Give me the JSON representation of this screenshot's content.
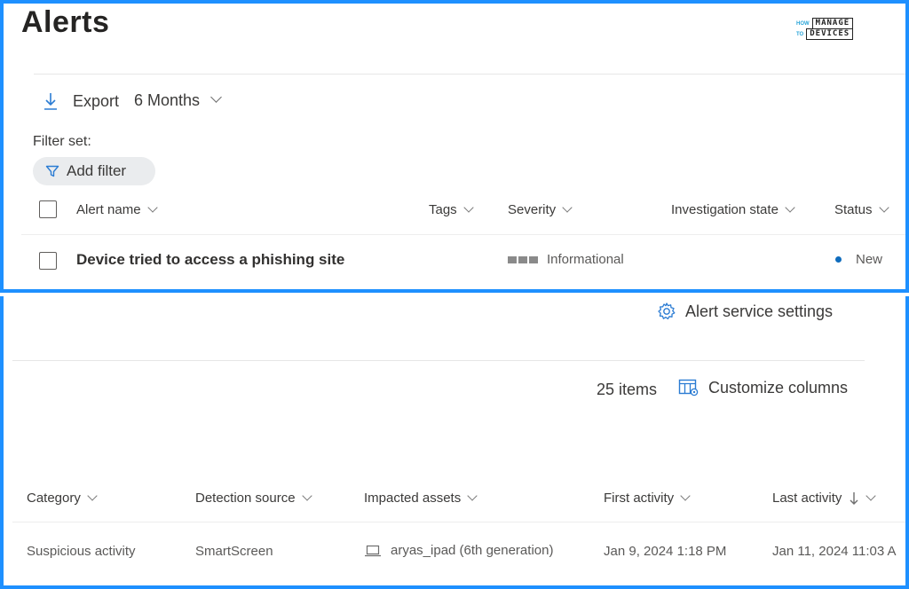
{
  "page": {
    "title": "Alerts"
  },
  "logo": {
    "line1a": "HOW",
    "line1b": "MANAGE",
    "line2a": "TO",
    "line2b": "DEVICES"
  },
  "toolbar": {
    "export_label": "Export",
    "range_label": "6 Months"
  },
  "filters": {
    "set_label": "Filter set:",
    "add_filter_label": "Add filter"
  },
  "settings": {
    "label": "Alert service settings"
  },
  "summary": {
    "items_count": "25 items",
    "customize_label": "Customize columns"
  },
  "table": {
    "columns_top": [
      "Alert name",
      "Tags",
      "Severity",
      "Investigation state",
      "Status"
    ],
    "columns_bottom": [
      "Category",
      "Detection source",
      "Impacted assets",
      "First activity",
      "Last activity"
    ],
    "rows": [
      {
        "alert_name": "Device tried to access a phishing site",
        "severity": "Informational",
        "status": "New",
        "category": "Suspicious activity",
        "detection_source": "SmartScreen",
        "impacted_asset": "aryas_ipad (6th generation)",
        "first_activity": "Jan 9, 2024 1:18 PM",
        "last_activity": "Jan 11, 2024 11:03 A"
      }
    ]
  },
  "colors": {
    "border": "#1e90ff",
    "status_dot": "#0f6cbd",
    "severity_block": "#8a8a8a",
    "icon_blue": "#2b7cd3"
  }
}
